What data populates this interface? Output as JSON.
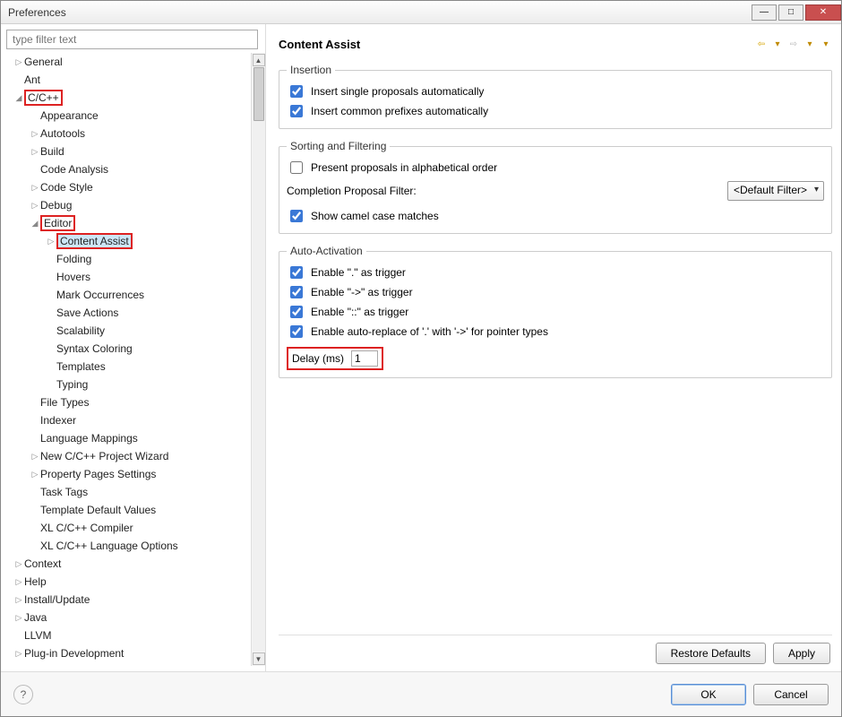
{
  "window": {
    "title": "Preferences"
  },
  "filter": {
    "placeholder": "type filter text"
  },
  "tree": [
    {
      "d": 1,
      "e": "▷",
      "l": "General"
    },
    {
      "d": 1,
      "e": "",
      "l": "Ant"
    },
    {
      "d": 1,
      "e": "◢",
      "l": "C/C++",
      "hl": true
    },
    {
      "d": 2,
      "e": "",
      "l": "Appearance"
    },
    {
      "d": 2,
      "e": "▷",
      "l": "Autotools"
    },
    {
      "d": 2,
      "e": "▷",
      "l": "Build"
    },
    {
      "d": 2,
      "e": "",
      "l": "Code Analysis"
    },
    {
      "d": 2,
      "e": "▷",
      "l": "Code Style"
    },
    {
      "d": 2,
      "e": "▷",
      "l": "Debug"
    },
    {
      "d": 2,
      "e": "◢",
      "l": "Editor",
      "hl": true
    },
    {
      "d": 3,
      "e": "▷",
      "l": "Content Assist",
      "hl": true,
      "sel": true
    },
    {
      "d": 3,
      "e": "",
      "l": "Folding"
    },
    {
      "d": 3,
      "e": "",
      "l": "Hovers"
    },
    {
      "d": 3,
      "e": "",
      "l": "Mark Occurrences"
    },
    {
      "d": 3,
      "e": "",
      "l": "Save Actions"
    },
    {
      "d": 3,
      "e": "",
      "l": "Scalability"
    },
    {
      "d": 3,
      "e": "",
      "l": "Syntax Coloring"
    },
    {
      "d": 3,
      "e": "",
      "l": "Templates"
    },
    {
      "d": 3,
      "e": "",
      "l": "Typing"
    },
    {
      "d": 2,
      "e": "",
      "l": "File Types"
    },
    {
      "d": 2,
      "e": "",
      "l": "Indexer"
    },
    {
      "d": 2,
      "e": "",
      "l": "Language Mappings"
    },
    {
      "d": 2,
      "e": "▷",
      "l": "New C/C++ Project Wizard"
    },
    {
      "d": 2,
      "e": "▷",
      "l": "Property Pages Settings"
    },
    {
      "d": 2,
      "e": "",
      "l": "Task Tags"
    },
    {
      "d": 2,
      "e": "",
      "l": "Template Default Values"
    },
    {
      "d": 2,
      "e": "",
      "l": "XL C/C++ Compiler"
    },
    {
      "d": 2,
      "e": "",
      "l": "XL C/C++ Language Options"
    },
    {
      "d": 1,
      "e": "▷",
      "l": "Context"
    },
    {
      "d": 1,
      "e": "▷",
      "l": "Help"
    },
    {
      "d": 1,
      "e": "▷",
      "l": "Install/Update"
    },
    {
      "d": 1,
      "e": "▷",
      "l": "Java"
    },
    {
      "d": 1,
      "e": "",
      "l": "LLVM"
    },
    {
      "d": 1,
      "e": "▷",
      "l": "Plug-in Development"
    }
  ],
  "page": {
    "title": "Content Assist",
    "groups": {
      "insertion": {
        "legend": "Insertion",
        "opt1": "Insert single proposals automatically",
        "opt2": "Insert common prefixes automatically"
      },
      "sorting": {
        "legend": "Sorting and Filtering",
        "opt1": "Present proposals in alphabetical order",
        "filter_label": "Completion Proposal Filter:",
        "filter_value": "<Default Filter>",
        "opt2": "Show camel case matches"
      },
      "auto": {
        "legend": "Auto-Activation",
        "opt1": "Enable \".\" as trigger",
        "opt2": "Enable \"->\" as trigger",
        "opt3": "Enable \"::\" as trigger",
        "opt4": "Enable auto-replace of '.' with '->' for pointer types",
        "delay_label": "Delay (ms)",
        "delay_value": "1"
      }
    },
    "buttons": {
      "restore": "Restore Defaults",
      "apply": "Apply",
      "ok": "OK",
      "cancel": "Cancel"
    }
  }
}
